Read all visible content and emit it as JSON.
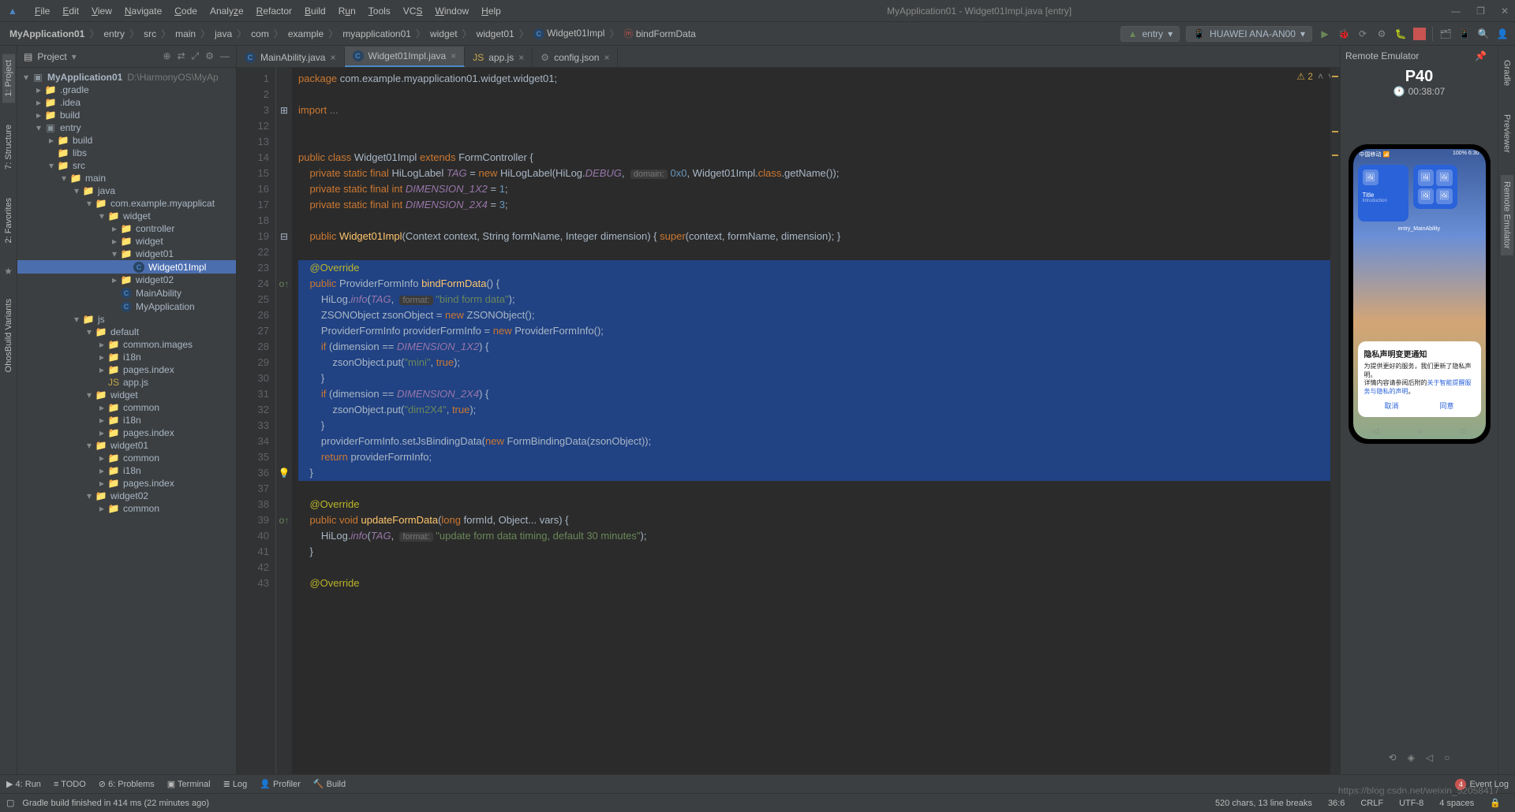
{
  "menubar": {
    "items": [
      "File",
      "Edit",
      "View",
      "Navigate",
      "Code",
      "Analyze",
      "Refactor",
      "Build",
      "Run",
      "Tools",
      "VCS",
      "Window",
      "Help"
    ],
    "title": "MyApplication01 - Widget01Impl.java [entry]"
  },
  "breadcrumb": [
    "MyApplication01",
    "entry",
    "src",
    "main",
    "java",
    "com",
    "example",
    "myapplication01",
    "widget",
    "widget01",
    "Widget01Impl",
    "bindFormData"
  ],
  "run_config": "entry",
  "device": "HUAWEI ANA-AN00",
  "project_panel": {
    "title": "Project"
  },
  "tree": {
    "root": {
      "name": "MyApplication01",
      "path": "D:\\HarmonyOS\\MyAp"
    },
    "nodes": [
      {
        "d": 1,
        "a": "▸",
        "i": "fo",
        "n": ".gradle"
      },
      {
        "d": 1,
        "a": "▸",
        "i": "fo",
        "n": ".idea"
      },
      {
        "d": 1,
        "a": "▸",
        "i": "fo",
        "n": "build"
      },
      {
        "d": 1,
        "a": "▾",
        "i": "mo",
        "n": "entry"
      },
      {
        "d": 2,
        "a": "▸",
        "i": "fo",
        "n": "build"
      },
      {
        "d": 2,
        "a": "",
        "i": "f",
        "n": "libs"
      },
      {
        "d": 2,
        "a": "▾",
        "i": "f",
        "n": "src"
      },
      {
        "d": 3,
        "a": "▾",
        "i": "f",
        "n": "main"
      },
      {
        "d": 4,
        "a": "▾",
        "i": "f",
        "n": "java"
      },
      {
        "d": 5,
        "a": "▾",
        "i": "f",
        "n": "com.example.myapplicat"
      },
      {
        "d": 6,
        "a": "▾",
        "i": "f",
        "n": "widget"
      },
      {
        "d": 7,
        "a": "▸",
        "i": "f",
        "n": "controller"
      },
      {
        "d": 7,
        "a": "▸",
        "i": "f",
        "n": "widget"
      },
      {
        "d": 7,
        "a": "▾",
        "i": "f",
        "n": "widget01"
      },
      {
        "d": 8,
        "a": "",
        "i": "c",
        "n": "Widget01Impl",
        "sel": true
      },
      {
        "d": 7,
        "a": "▸",
        "i": "f",
        "n": "widget02"
      },
      {
        "d": 7,
        "a": "",
        "i": "c",
        "n": "MainAbility"
      },
      {
        "d": 7,
        "a": "",
        "i": "c",
        "n": "MyApplication"
      },
      {
        "d": 4,
        "a": "▾",
        "i": "f",
        "n": "js"
      },
      {
        "d": 5,
        "a": "▾",
        "i": "f",
        "n": "default"
      },
      {
        "d": 6,
        "a": "▸",
        "i": "f",
        "n": "common.images"
      },
      {
        "d": 6,
        "a": "▸",
        "i": "f",
        "n": "i18n"
      },
      {
        "d": 6,
        "a": "▸",
        "i": "f",
        "n": "pages.index"
      },
      {
        "d": 6,
        "a": "",
        "i": "js",
        "n": "app.js"
      },
      {
        "d": 5,
        "a": "▾",
        "i": "f",
        "n": "widget"
      },
      {
        "d": 6,
        "a": "▸",
        "i": "f",
        "n": "common"
      },
      {
        "d": 6,
        "a": "▸",
        "i": "f",
        "n": "i18n"
      },
      {
        "d": 6,
        "a": "▸",
        "i": "f",
        "n": "pages.index"
      },
      {
        "d": 5,
        "a": "▾",
        "i": "f",
        "n": "widget01"
      },
      {
        "d": 6,
        "a": "▸",
        "i": "f",
        "n": "common"
      },
      {
        "d": 6,
        "a": "▸",
        "i": "f",
        "n": "i18n"
      },
      {
        "d": 6,
        "a": "▸",
        "i": "f",
        "n": "pages.index"
      },
      {
        "d": 5,
        "a": "▾",
        "i": "f",
        "n": "widget02"
      },
      {
        "d": 6,
        "a": "▸",
        "i": "f",
        "n": "common"
      }
    ]
  },
  "tabs": [
    {
      "icon": "c",
      "label": "MainAbility.java",
      "active": false
    },
    {
      "icon": "c",
      "label": "Widget01Impl.java",
      "active": true
    },
    {
      "icon": "js",
      "label": "app.js",
      "active": false
    },
    {
      "icon": "cfg",
      "label": "config.json",
      "active": false
    }
  ],
  "editor": {
    "warnings": "2",
    "lines_start": 1,
    "lines": [
      1,
      2,
      3,
      12,
      13,
      14,
      15,
      16,
      17,
      18,
      19,
      22,
      23,
      24,
      25,
      26,
      27,
      28,
      29,
      30,
      31,
      32,
      33,
      34,
      35,
      36,
      37,
      38,
      39,
      40,
      41,
      42,
      43
    ]
  },
  "emulator": {
    "header": "Remote Emulator",
    "device": "P40",
    "time": "00:38:07",
    "statusbar_left": "中国移动 📶",
    "statusbar_right": "100% 6:30",
    "widget_title": "Title",
    "widget_sub": "Introduction",
    "entry_label": "entry_MainAbility",
    "dialog": {
      "title": "隐私声明变更通知",
      "body1": "为提供更好的服务，我们更新了隐私声明。",
      "body2": "详情内容请参阅后附的",
      "link": "关于智能提醒服务与隐私的声明",
      "sep": "。",
      "cancel": "取消",
      "agree": "同意"
    }
  },
  "bottom_tabs": {
    "run": "4: Run",
    "todo": "TODO",
    "problems": "6: Problems",
    "terminal": "Terminal",
    "log": "Log",
    "profiler": "Profiler",
    "build": "Build",
    "event_log": "Event Log",
    "event_badge": "4"
  },
  "statusbar": {
    "msg": "Gradle build finished in 414 ms (22 minutes ago)",
    "chars": "520 chars, 13 line breaks",
    "pos": "36:6",
    "eol": "CRLF",
    "enc": "UTF-8",
    "indent": "4 spaces"
  },
  "watermark": "https://blog.csdn.net/weixin_52058417",
  "left_tabs": [
    "1: Project",
    "7: Structure",
    "2: Favorites",
    "OhosBuild Variants"
  ],
  "right_tabs": [
    "Gradle",
    "Previewer",
    "Remote Emulator"
  ]
}
